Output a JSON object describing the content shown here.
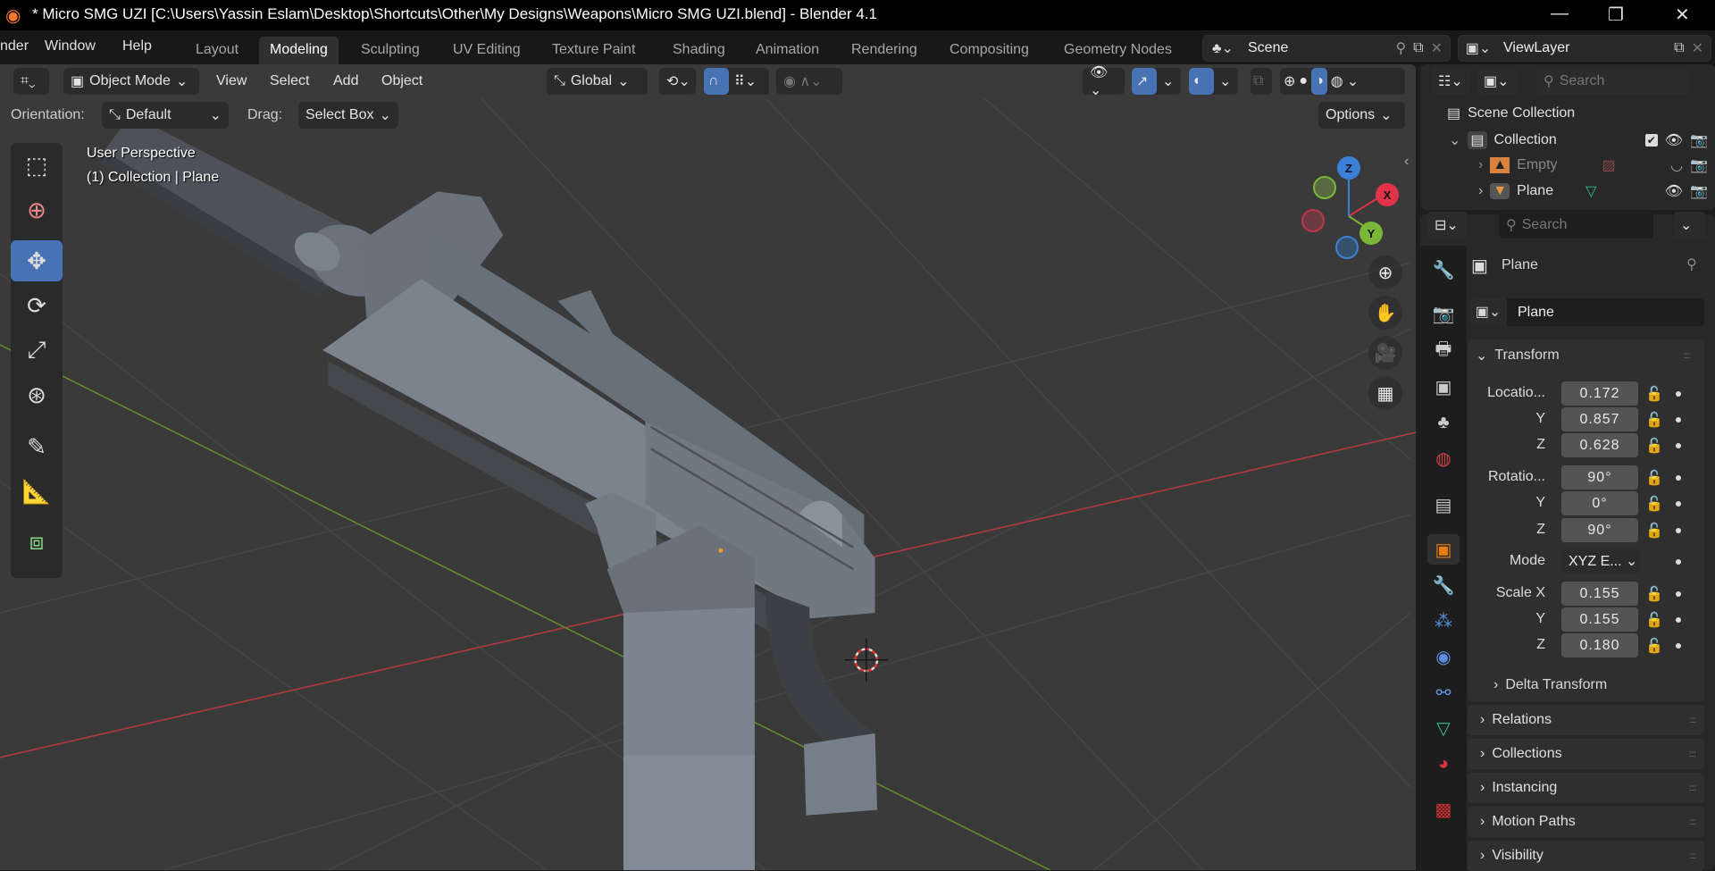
{
  "window": {
    "title": "* Micro SMG UZI [C:\\Users\\Yassin Eslam\\Desktop\\Shortcuts\\Other\\My Designs\\Weapons\\Micro SMG UZI.blend] - Blender 4.1",
    "minimize": "—",
    "maximize": "❐",
    "close": "✕"
  },
  "menus": [
    "nder",
    "Window",
    "Help"
  ],
  "workspaces": [
    "Layout",
    "Modeling",
    "Sculpting",
    "UV Editing",
    "Texture Paint",
    "Shading",
    "Animation",
    "Rendering",
    "Compositing",
    "Geometry Nodes"
  ],
  "active_workspace": "Modeling",
  "scene": {
    "name": "Scene",
    "view_layer": "ViewLayer"
  },
  "viewport_header": {
    "mode": "Object Mode",
    "menus": [
      "View",
      "Select",
      "Add",
      "Object"
    ],
    "orientation_global": "Global"
  },
  "tool_settings": {
    "orientation_label": "Orientation:",
    "orientation_value": "Default",
    "drag_label": "Drag:",
    "drag_value": "Select Box",
    "options": "Options"
  },
  "overlay": {
    "view_name": "User Perspective",
    "collection_info": "(1) Collection | Plane"
  },
  "gizmo": {
    "x": "X",
    "y": "Y",
    "z": "Z"
  },
  "outliner": {
    "search_placeholder": "Search",
    "scene_collection": "Scene Collection",
    "collection": "Collection",
    "items": [
      "Empty",
      "Plane"
    ]
  },
  "properties": {
    "search_placeholder": "Search",
    "object_name": "Plane",
    "datablock": "Plane",
    "transform": {
      "title": "Transform",
      "location_label": "Locatio...",
      "location": [
        "0.172",
        "0.857",
        "0.628"
      ],
      "rotation_label": "Rotatio...",
      "rotation": [
        "90°",
        "0°",
        "90°"
      ],
      "mode_label": "Mode",
      "mode_value": "XYZ E...",
      "scale_label": "Scale X",
      "scale": [
        "0.155",
        "0.155",
        "0.180"
      ],
      "y": "Y",
      "z": "Z"
    },
    "subpanels": [
      "Delta Transform",
      "Relations",
      "Collections",
      "Instancing",
      "Motion Paths",
      "Visibility"
    ]
  },
  "colors": {
    "accent": "#4772b3",
    "x_axis": "#e0334a",
    "y_axis": "#7ab638",
    "z_axis": "#3b7fd6",
    "active_tab": "#e87d0d"
  }
}
